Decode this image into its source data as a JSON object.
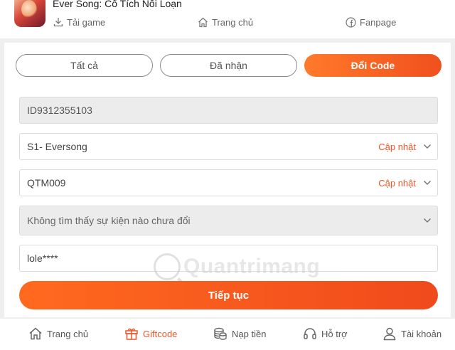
{
  "header": {
    "app_title": "Ever Song: Cổ Tích Nổi Loạn",
    "download_label": "Tải game",
    "home_label": "Trang chủ",
    "fanpage_label": "Fanpage"
  },
  "tabs": [
    {
      "label": "Tất cả",
      "active": false
    },
    {
      "label": "Đã nhận",
      "active": false
    },
    {
      "label": "Đổi Code",
      "active": true
    }
  ],
  "form": {
    "player_id": "ID9312355103",
    "server": {
      "value": "S1- Eversong",
      "action": "Cập nhật"
    },
    "character": {
      "value": "QTM009",
      "action": "Cập nhật"
    },
    "event": {
      "value": "Không tìm thấy sự kiện nào chưa đổi"
    },
    "code": {
      "value": "lole****"
    },
    "submit_label": "Tiếp tục"
  },
  "watermark": "Quantrimang",
  "bottom_nav": [
    {
      "label": "Trang chủ",
      "icon": "home-icon",
      "active": false
    },
    {
      "label": "Giftcode",
      "icon": "gift-icon",
      "active": true
    },
    {
      "label": "Nạp tiền",
      "icon": "coins-icon",
      "active": false
    },
    {
      "label": "Hỗ trợ",
      "icon": "headset-icon",
      "active": false
    },
    {
      "label": "Tài khoản",
      "icon": "user-icon",
      "active": false
    }
  ],
  "colors": {
    "accent": "#f0501e",
    "accent_light": "#ff7a2a",
    "muted": "#666666"
  }
}
